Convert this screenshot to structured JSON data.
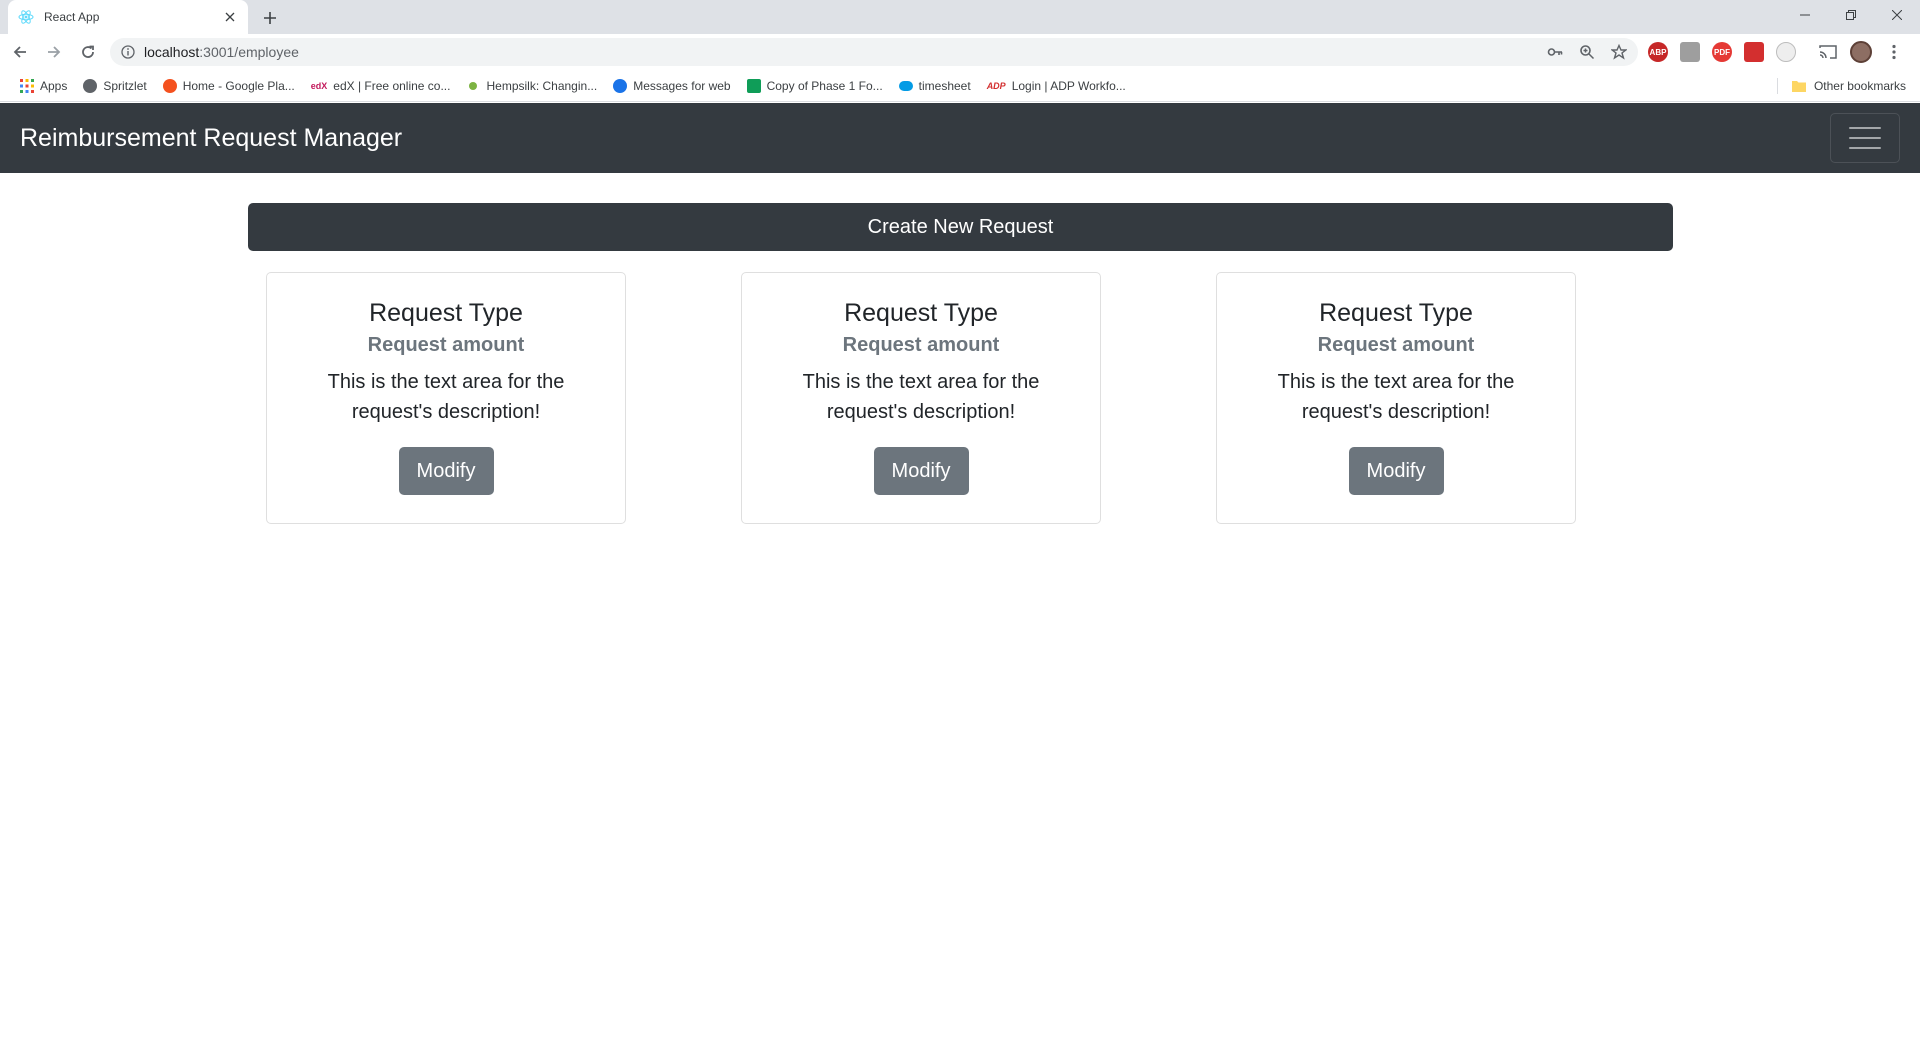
{
  "browser": {
    "tab_title": "React App",
    "url_host": "localhost",
    "url_rest": ":3001/employee",
    "bookmarks": [
      {
        "label": "Apps",
        "color": "#ea4335"
      },
      {
        "label": "Spritzlet",
        "color": "#5f6368"
      },
      {
        "label": "Home - Google Pla...",
        "color": "#f4511e"
      },
      {
        "label": "edX | Free online co...",
        "color": "#c2185b"
      },
      {
        "label": "Hempsilk: Changin...",
        "color": "#7cb342"
      },
      {
        "label": "Messages for web",
        "color": "#1a73e8"
      },
      {
        "label": "Copy of Phase 1 Fo...",
        "color": "#0f9d58"
      },
      {
        "label": "timesheet",
        "color": "#039be5"
      },
      {
        "label": "Login | ADP Workfo...",
        "color": "#d32f2f"
      }
    ],
    "other_bookmarks": "Other bookmarks",
    "extensions": [
      {
        "label": "ABP",
        "color": "#c62828"
      },
      {
        "label": "",
        "color": "#9e9e9e"
      },
      {
        "label": "PDF",
        "color": "#e53935"
      },
      {
        "label": "",
        "color": "#d32f2f"
      },
      {
        "label": "",
        "color": "#bdbdbd"
      }
    ]
  },
  "navbar": {
    "brand": "Reimbursement Request Manager"
  },
  "main": {
    "create_label": "Create New Request",
    "cards": [
      {
        "title": "Request Type",
        "subtitle": "Request amount",
        "text": "This is the text area for the request's description!",
        "button": "Modify"
      },
      {
        "title": "Request Type",
        "subtitle": "Request amount",
        "text": "This is the text area for the request's description!",
        "button": "Modify"
      },
      {
        "title": "Request Type",
        "subtitle": "Request amount",
        "text": "This is the text area for the request's description!",
        "button": "Modify"
      }
    ]
  }
}
